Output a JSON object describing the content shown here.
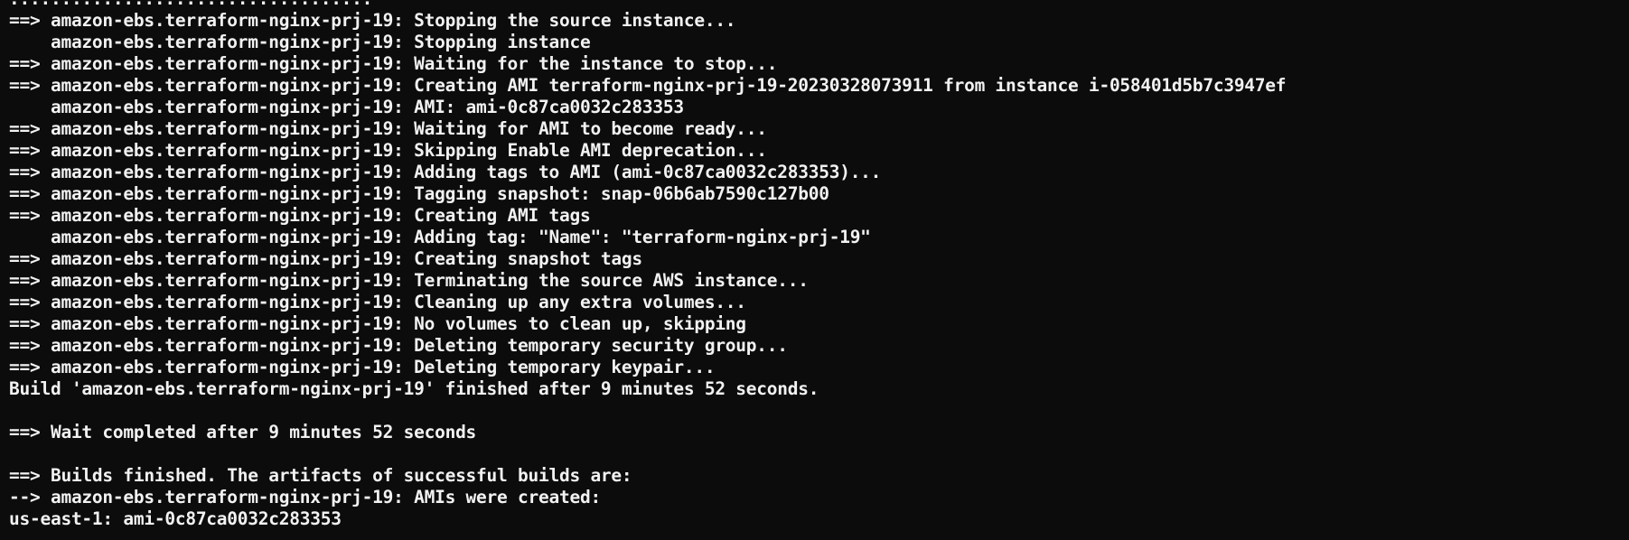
{
  "terminal": {
    "lines": [
      "...................................",
      "==> amazon-ebs.terraform-nginx-prj-19: Stopping the source instance...",
      "    amazon-ebs.terraform-nginx-prj-19: Stopping instance",
      "==> amazon-ebs.terraform-nginx-prj-19: Waiting for the instance to stop...",
      "==> amazon-ebs.terraform-nginx-prj-19: Creating AMI terraform-nginx-prj-19-20230328073911 from instance i-058401d5b7c3947ef",
      "    amazon-ebs.terraform-nginx-prj-19: AMI: ami-0c87ca0032c283353",
      "==> amazon-ebs.terraform-nginx-prj-19: Waiting for AMI to become ready...",
      "==> amazon-ebs.terraform-nginx-prj-19: Skipping Enable AMI deprecation...",
      "==> amazon-ebs.terraform-nginx-prj-19: Adding tags to AMI (ami-0c87ca0032c283353)...",
      "==> amazon-ebs.terraform-nginx-prj-19: Tagging snapshot: snap-06b6ab7590c127b00",
      "==> amazon-ebs.terraform-nginx-prj-19: Creating AMI tags",
      "    amazon-ebs.terraform-nginx-prj-19: Adding tag: \"Name\": \"terraform-nginx-prj-19\"",
      "==> amazon-ebs.terraform-nginx-prj-19: Creating snapshot tags",
      "==> amazon-ebs.terraform-nginx-prj-19: Terminating the source AWS instance...",
      "==> amazon-ebs.terraform-nginx-prj-19: Cleaning up any extra volumes...",
      "==> amazon-ebs.terraform-nginx-prj-19: No volumes to clean up, skipping",
      "==> amazon-ebs.terraform-nginx-prj-19: Deleting temporary security group...",
      "==> amazon-ebs.terraform-nginx-prj-19: Deleting temporary keypair...",
      "Build 'amazon-ebs.terraform-nginx-prj-19' finished after 9 minutes 52 seconds.",
      "",
      "==> Wait completed after 9 minutes 52 seconds",
      "",
      "==> Builds finished. The artifacts of successful builds are:",
      "--> amazon-ebs.terraform-nginx-prj-19: AMIs were created:",
      "us-east-1: ami-0c87ca0032c283353"
    ]
  }
}
